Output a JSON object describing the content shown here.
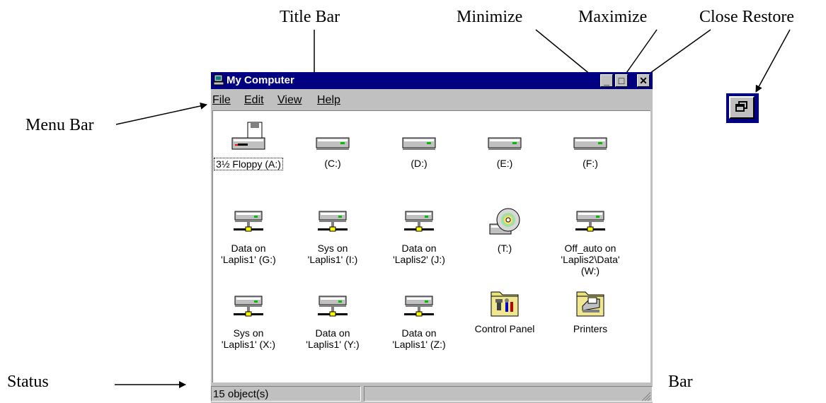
{
  "callouts": {
    "title_bar": "Title Bar",
    "minimize": "Minimize",
    "maximize": "Maximize",
    "close_restore": "Close Restore",
    "menu_bar": "Menu Bar",
    "status": "Status",
    "bar": "Bar"
  },
  "window": {
    "title": "My Computer",
    "title_icon": "computer-icon",
    "buttons": {
      "minimize": "_",
      "maximize": "□",
      "close": "✕"
    }
  },
  "menu": [
    "File",
    "Edit",
    "View",
    "Help"
  ],
  "items": [
    {
      "label": "3½ Floppy (A:)",
      "icon": "floppy-drive-icon",
      "selected": true
    },
    {
      "label": "(C:)",
      "icon": "hard-drive-icon"
    },
    {
      "label": "(D:)",
      "icon": "hard-drive-icon"
    },
    {
      "label": "(E:)",
      "icon": "hard-drive-icon"
    },
    {
      "label": "(F:)",
      "icon": "hard-drive-icon"
    },
    {
      "label": "Data on\n'Laplis1' (G:)",
      "icon": "network-drive-icon"
    },
    {
      "label": "Sys on\n'Laplis1' (I:)",
      "icon": "network-drive-icon"
    },
    {
      "label": "Data on\n'Laplis2' (J:)",
      "icon": "network-drive-icon"
    },
    {
      "label": "(T:)",
      "icon": "cd-rom-drive-icon"
    },
    {
      "label": "Off_auto on\n'Laplis2\\Data'\n(W:)",
      "icon": "network-drive-icon"
    },
    {
      "label": "Sys on\n'Laplis1' (X:)",
      "icon": "network-drive-icon"
    },
    {
      "label": "Data on\n'Laplis1' (Y:)",
      "icon": "network-drive-icon"
    },
    {
      "label": "Data on\n'Laplis1' (Z:)",
      "icon": "network-drive-icon"
    },
    {
      "label": "Control Panel",
      "icon": "control-panel-folder-icon"
    },
    {
      "label": "Printers",
      "icon": "printers-folder-icon"
    }
  ],
  "status": {
    "text": "15 object(s)"
  },
  "restore_button": {
    "icon": "restore-icon"
  },
  "colors": {
    "title_bar": "#000080",
    "face": "#c0c0c0",
    "content_bg": "#ffffff",
    "drive_led": "#00c000"
  }
}
